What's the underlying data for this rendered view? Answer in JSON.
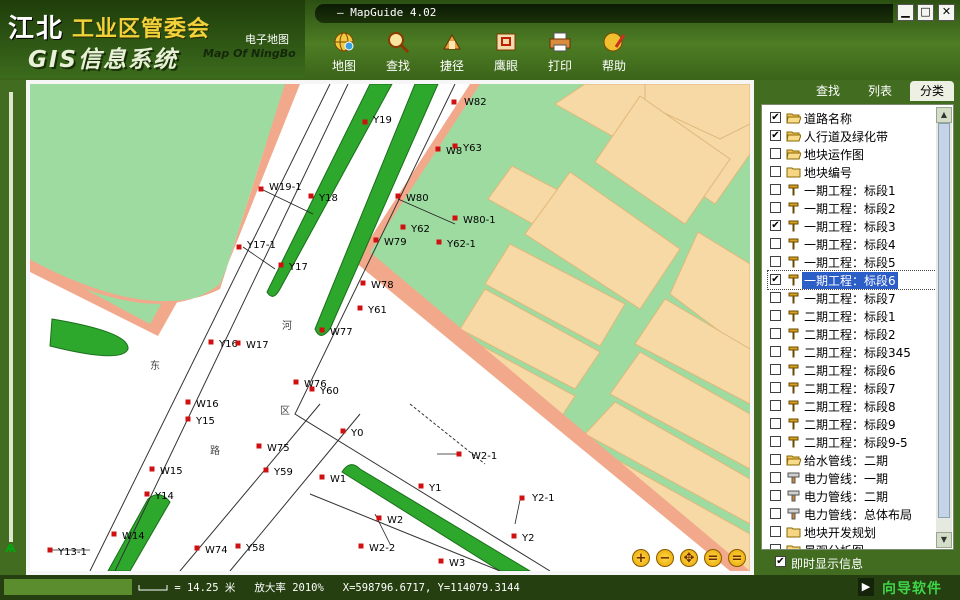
{
  "header": {
    "org_prefix": "江北",
    "org_name": "工业区管委会",
    "gis_title": "GIS信息系统",
    "map_label": "电子地图",
    "map_subtitle": "Map Of NingBo"
  },
  "window": {
    "title": "MapGuide 4.02",
    "title_prefix": "—",
    "min_glyph": "▁",
    "max_glyph": "□",
    "close_glyph": "✕"
  },
  "toolbar": [
    {
      "label": "地图",
      "icon": "globe-icon"
    },
    {
      "label": "查找",
      "icon": "magnifier-icon"
    },
    {
      "label": "捷径",
      "icon": "shortcut-icon"
    },
    {
      "label": "鹰眼",
      "icon": "eagle-eye-icon"
    },
    {
      "label": "打印",
      "icon": "printer-icon"
    },
    {
      "label": "帮助",
      "icon": "help-icon"
    }
  ],
  "tabs": [
    "查找",
    "列表",
    "分类"
  ],
  "active_tab": "分类",
  "layers": [
    {
      "label": "道路名称",
      "checked": true,
      "icon": "folder-open-icon"
    },
    {
      "label": "人行道及绿化带",
      "checked": true,
      "icon": "folder-open-icon"
    },
    {
      "label": "地块运作图",
      "checked": false,
      "icon": "folder-open-icon"
    },
    {
      "label": "地块编号",
      "checked": false,
      "icon": "folder-icon"
    },
    {
      "label": "一期工程：标段1",
      "checked": false,
      "icon": "layer-icon"
    },
    {
      "label": "一期工程：标段2",
      "checked": false,
      "icon": "layer-icon"
    },
    {
      "label": "一期工程：标段3",
      "checked": true,
      "icon": "layer-icon"
    },
    {
      "label": "一期工程：标段4",
      "checked": false,
      "icon": "layer-icon"
    },
    {
      "label": "一期工程：标段5",
      "checked": false,
      "icon": "layer-icon"
    },
    {
      "label": "一期工程：标段6",
      "checked": true,
      "icon": "layer-icon",
      "selected": true
    },
    {
      "label": "一期工程：标段7",
      "checked": false,
      "icon": "layer-icon"
    },
    {
      "label": "二期工程：标段1",
      "checked": false,
      "icon": "layer-icon"
    },
    {
      "label": "二期工程：标段2",
      "checked": false,
      "icon": "layer-icon"
    },
    {
      "label": "二期工程：标段345",
      "checked": false,
      "icon": "layer-icon"
    },
    {
      "label": "二期工程：标段6",
      "checked": false,
      "icon": "layer-icon"
    },
    {
      "label": "二期工程：标段7",
      "checked": false,
      "icon": "layer-icon"
    },
    {
      "label": "二期工程：标段8",
      "checked": false,
      "icon": "layer-icon"
    },
    {
      "label": "二期工程：标段9",
      "checked": false,
      "icon": "layer-icon"
    },
    {
      "label": "二期工程：标段9-5",
      "checked": false,
      "icon": "layer-icon"
    },
    {
      "label": "给水管线：二期",
      "checked": false,
      "icon": "folder-open-icon"
    },
    {
      "label": "电力管线：一期",
      "checked": false,
      "icon": "pipe-icon"
    },
    {
      "label": "电力管线：二期",
      "checked": false,
      "icon": "pipe-icon"
    },
    {
      "label": "电力管线：总体布局",
      "checked": false,
      "icon": "pipe-icon"
    },
    {
      "label": "地块开发规划",
      "checked": false,
      "icon": "folder-icon"
    },
    {
      "label": "景观分析图",
      "checked": false,
      "icon": "folder-icon"
    }
  ],
  "instant_display": {
    "label": "即时显示信息",
    "checked": true
  },
  "status": {
    "scale_text": "= 14.25 米",
    "zoom_label": "放大率",
    "zoom_value": "2010%",
    "coords": "X=598796.6717, Y=114079.3144",
    "brand": "向导软件",
    "next_glyph": "▶"
  },
  "map_controls": [
    "+",
    "−",
    "✥",
    "=",
    "="
  ],
  "map_labels": {
    "points": [
      {
        "label": "W82"
      },
      {
        "label": "Y19"
      },
      {
        "label": "W8"
      },
      {
        "label": "Y63"
      },
      {
        "label": "Y18"
      },
      {
        "label": "W19-1"
      },
      {
        "label": "W80"
      },
      {
        "label": "W80-1"
      },
      {
        "label": "Y62"
      },
      {
        "label": "Y62-1"
      },
      {
        "label": "W79"
      },
      {
        "label": "Y17-1"
      },
      {
        "label": "Y17"
      },
      {
        "label": "W78"
      },
      {
        "label": "Y61"
      },
      {
        "label": "W77"
      },
      {
        "label": "Y16"
      },
      {
        "label": "W17"
      },
      {
        "label": "W76"
      },
      {
        "label": "Y60"
      },
      {
        "label": "W16"
      },
      {
        "label": "Y15"
      },
      {
        "label": "Y0"
      },
      {
        "label": "W75"
      },
      {
        "label": "W2-1"
      },
      {
        "label": "W15"
      },
      {
        "label": "Y59"
      },
      {
        "label": "W1"
      },
      {
        "label": "Y1"
      },
      {
        "label": "Y14"
      },
      {
        "label": "Y2-1"
      },
      {
        "label": "W14"
      },
      {
        "label": "W2"
      },
      {
        "label": "Y2"
      },
      {
        "label": "Y13-1"
      },
      {
        "label": "W74"
      },
      {
        "label": "Y58"
      },
      {
        "label": "W2-2"
      },
      {
        "label": "W3"
      }
    ],
    "road_text": [
      "东",
      "路",
      "区",
      "河"
    ]
  }
}
